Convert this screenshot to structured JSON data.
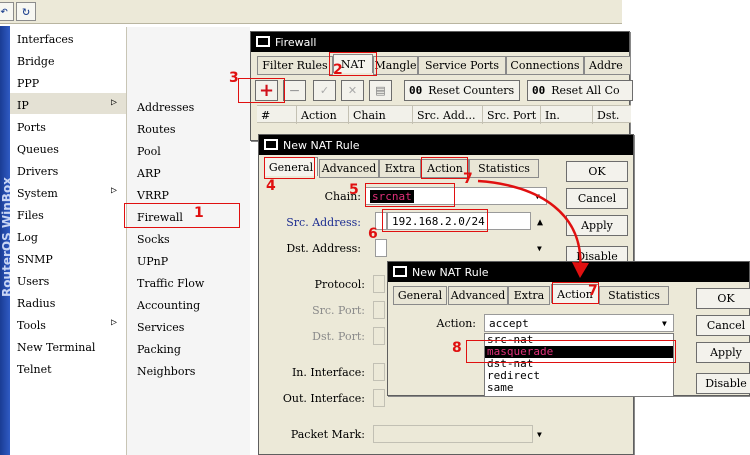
{
  "toolbar": {
    "back_icon": "arrow-back-icon",
    "refresh_icon": "refresh-icon"
  },
  "sidebar": {
    "brand_text": "RouterOS WinBox",
    "items": [
      {
        "label": "Interfaces"
      },
      {
        "label": "Bridge"
      },
      {
        "label": "PPP"
      },
      {
        "label": "IP"
      },
      {
        "label": "Ports"
      },
      {
        "label": "Queues"
      },
      {
        "label": "Drivers"
      },
      {
        "label": "System"
      },
      {
        "label": "Files"
      },
      {
        "label": "Log"
      },
      {
        "label": "SNMP"
      },
      {
        "label": "Users"
      },
      {
        "label": "Radius"
      },
      {
        "label": "Tools"
      },
      {
        "label": "New Terminal"
      },
      {
        "label": "Telnet"
      }
    ]
  },
  "submenu": {
    "items": [
      {
        "label": "Addresses"
      },
      {
        "label": "Routes"
      },
      {
        "label": "Pool"
      },
      {
        "label": "ARP"
      },
      {
        "label": "VRRP"
      },
      {
        "label": "Firewall"
      },
      {
        "label": "Socks"
      },
      {
        "label": "UPnP"
      },
      {
        "label": "Traffic Flow"
      },
      {
        "label": "Accounting"
      },
      {
        "label": "Services"
      },
      {
        "label": "Packing"
      },
      {
        "label": "Neighbors"
      }
    ]
  },
  "firewall_window": {
    "title": "Firewall",
    "tabs": [
      {
        "label": "Filter Rules"
      },
      {
        "label": "NAT"
      },
      {
        "label": "Mangle"
      },
      {
        "label": "Service Ports"
      },
      {
        "label": "Connections"
      },
      {
        "label": "Addre"
      }
    ],
    "reset_counters_label": "Reset Counters",
    "reset_all_label": "Reset All Co",
    "counter_prefix": "00",
    "columns": [
      {
        "label": "#"
      },
      {
        "label": "Action"
      },
      {
        "label": "Chain"
      },
      {
        "label": "Src. Add..."
      },
      {
        "label": "Src. Port"
      },
      {
        "label": "In."
      },
      {
        "label": "Dst."
      }
    ]
  },
  "nat_rule_1": {
    "title": "New NAT Rule",
    "tabs": [
      {
        "label": "General"
      },
      {
        "label": "Advanced"
      },
      {
        "label": "Extra"
      },
      {
        "label": "Action"
      },
      {
        "label": "Statistics"
      }
    ],
    "buttons": {
      "ok": "OK",
      "cancel": "Cancel",
      "apply": "Apply",
      "disable": "Disable"
    },
    "fields": {
      "chain_label": "Chain:",
      "chain_value": "srcnat",
      "src_address_label": "Src. Address:",
      "src_address_value": "192.168.2.0/24",
      "dst_address_label": "Dst. Address:",
      "protocol_label": "Protocol:",
      "src_port_label": "Src. Port:",
      "dst_port_label": "Dst. Port:",
      "in_interface_label": "In. Interface:",
      "out_interface_label": "Out. Interface:",
      "packet_mark_label": "Packet Mark:"
    }
  },
  "nat_rule_2": {
    "title": "New NAT Rule",
    "tabs": [
      {
        "label": "General"
      },
      {
        "label": "Advanced"
      },
      {
        "label": "Extra"
      },
      {
        "label": "Action"
      },
      {
        "label": "Statistics"
      }
    ],
    "buttons": {
      "ok": "OK",
      "cancel": "Cancel",
      "apply": "Apply",
      "disable": "Disable"
    },
    "action_label": "Action:",
    "action_value": "accept",
    "action_options": [
      {
        "label": "src-nat"
      },
      {
        "label": "masquerade"
      },
      {
        "label": "dst-nat"
      },
      {
        "label": "redirect"
      },
      {
        "label": "same"
      }
    ]
  },
  "annotations": [
    {
      "label": "1"
    },
    {
      "label": "2"
    },
    {
      "label": "3"
    },
    {
      "label": "4"
    },
    {
      "label": "5"
    },
    {
      "label": "6"
    },
    {
      "label": "7"
    },
    {
      "label": "7"
    },
    {
      "label": "8"
    }
  ],
  "colors": {
    "annotation": "#e01010",
    "selection": "#000000",
    "highlight": "#cc2255",
    "brand_strip": "#1a3c94"
  }
}
